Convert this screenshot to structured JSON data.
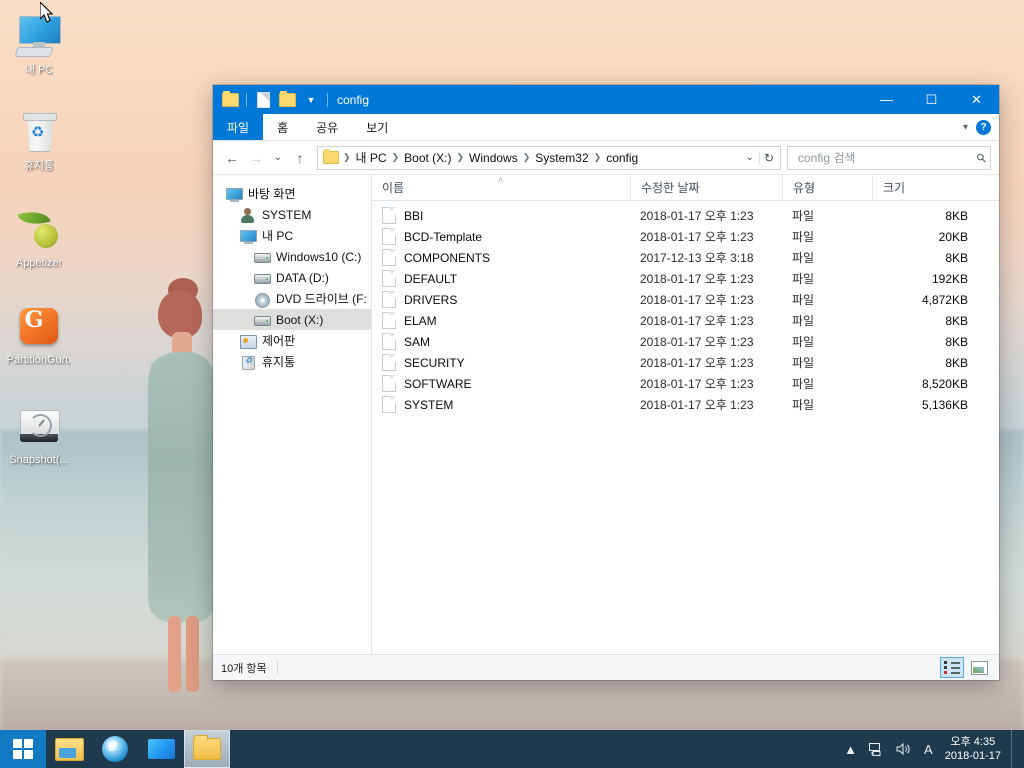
{
  "desktop": {
    "icons": [
      {
        "label": "내 PC",
        "icon": "computer-icon"
      },
      {
        "label": "휴지통",
        "icon": "recycle-bin-icon"
      },
      {
        "label": "Appetizer",
        "icon": "appetizer-leaf-icon"
      },
      {
        "label": "PartitionGuru",
        "icon": "partitionguru-icon"
      },
      {
        "label": "Snapshot(...",
        "icon": "snapshot-icon"
      }
    ]
  },
  "window": {
    "title": "config",
    "quick_access": [
      "folder-icon",
      "new-document-icon",
      "folder-icon"
    ],
    "controls": {
      "minimize": "—",
      "maximize": "☐",
      "close": "✕"
    },
    "ribbon_tabs": [
      {
        "label": "파일",
        "active": true
      },
      {
        "label": "홈",
        "active": false
      },
      {
        "label": "공유",
        "active": false
      },
      {
        "label": "보기",
        "active": false
      }
    ],
    "ribbon_expand_icon": "chevron-down-icon",
    "help_label": "?"
  },
  "nav": {
    "back_icon": "←",
    "forward_icon": "→",
    "recent_icon": "⌄",
    "up_icon": "↑",
    "breadcrumb": [
      "내 PC",
      "Boot (X:)",
      "Windows",
      "System32",
      "config"
    ],
    "breadcrumb_caret": "⌄",
    "refresh_icon": "↻",
    "search": {
      "value": "",
      "placeholder": "config 검색"
    }
  },
  "navpane": {
    "items": [
      {
        "label": "바탕 화면",
        "icon": "desktop-icon",
        "level": 1,
        "selected": false
      },
      {
        "label": "SYSTEM",
        "icon": "user-icon",
        "level": 2,
        "selected": false
      },
      {
        "label": "내 PC",
        "icon": "computer-icon",
        "level": 2,
        "selected": false
      },
      {
        "label": "Windows10 (C:)",
        "icon": "drive-icon",
        "level": 3,
        "selected": false
      },
      {
        "label": "DATA (D:)",
        "icon": "drive-icon",
        "level": 3,
        "selected": false
      },
      {
        "label": "DVD 드라이브 (F:",
        "icon": "dvd-icon",
        "level": 3,
        "selected": false
      },
      {
        "label": "Boot (X:)",
        "icon": "drive-icon",
        "level": 3,
        "selected": true
      },
      {
        "label": "제어판",
        "icon": "control-panel-icon",
        "level": 2,
        "selected": false
      },
      {
        "label": "휴지통",
        "icon": "recycle-bin-icon",
        "level": 2,
        "selected": false
      }
    ]
  },
  "filelist": {
    "columns": [
      {
        "label": "이름",
        "sorted": "asc"
      },
      {
        "label": "수정한 날짜",
        "sorted": ""
      },
      {
        "label": "유형",
        "sorted": ""
      },
      {
        "label": "크기",
        "sorted": ""
      }
    ],
    "sort_caret": "˄",
    "rows": [
      {
        "name": "BBI",
        "modified": "2018-01-17 오후 1:23",
        "type": "파일",
        "size": "8KB"
      },
      {
        "name": "BCD-Template",
        "modified": "2018-01-17 오후 1:23",
        "type": "파일",
        "size": "20KB"
      },
      {
        "name": "COMPONENTS",
        "modified": "2017-12-13 오후 3:18",
        "type": "파일",
        "size": "8KB"
      },
      {
        "name": "DEFAULT",
        "modified": "2018-01-17 오후 1:23",
        "type": "파일",
        "size": "192KB"
      },
      {
        "name": "DRIVERS",
        "modified": "2018-01-17 오후 1:23",
        "type": "파일",
        "size": "4,872KB"
      },
      {
        "name": "ELAM",
        "modified": "2018-01-17 오후 1:23",
        "type": "파일",
        "size": "8KB"
      },
      {
        "name": "SAM",
        "modified": "2018-01-17 오후 1:23",
        "type": "파일",
        "size": "8KB"
      },
      {
        "name": "SECURITY",
        "modified": "2018-01-17 오후 1:23",
        "type": "파일",
        "size": "8KB"
      },
      {
        "name": "SOFTWARE",
        "modified": "2018-01-17 오후 1:23",
        "type": "파일",
        "size": "8,520KB"
      },
      {
        "name": "SYSTEM",
        "modified": "2018-01-17 오후 1:23",
        "type": "파일",
        "size": "5,136KB"
      }
    ]
  },
  "statusbar": {
    "text": "10개 항목",
    "views": [
      {
        "name": "details-view",
        "active": true
      },
      {
        "name": "large-icons-view",
        "active": false
      }
    ]
  },
  "taskbar": {
    "start_label": "시작",
    "buttons": [
      {
        "name": "file-explorer-pinned",
        "icon": "folder-icon",
        "active": false
      },
      {
        "name": "internet-explorer-pinned",
        "icon": "ie-icon",
        "active": false
      },
      {
        "name": "display-app",
        "icon": "screen-icon",
        "active": false
      },
      {
        "name": "explorer-window",
        "icon": "folder-icon",
        "active": true
      }
    ],
    "tray": {
      "overflow_icon": "▲",
      "network_icon": "network-icon",
      "volume_icon": "🔊",
      "ime_icon": "A",
      "time": "오후 4:35",
      "date": "2018-01-17"
    }
  },
  "colors": {
    "accent": "#0078d7",
    "taskbar": "#1f3a4d",
    "selection": "#dededd",
    "view_active": "#cce6f7"
  }
}
